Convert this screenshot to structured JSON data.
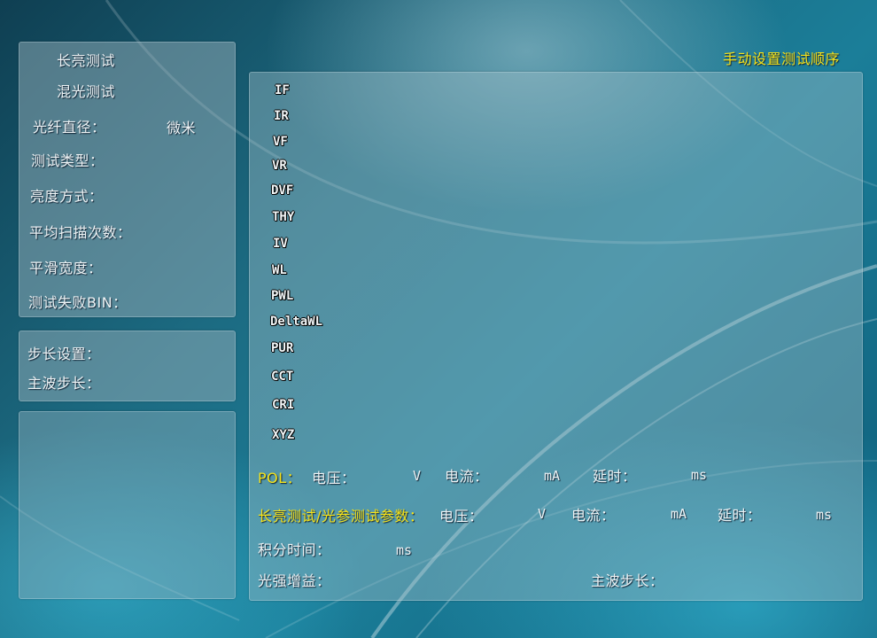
{
  "top_right_title": "手动设置测试顺序",
  "left_panel_1": {
    "long_bright_test": "长亮测试",
    "mixed_light_test": "混光测试",
    "fiber_diameter_label": "光纤直径：",
    "fiber_diameter_unit": "微米",
    "test_type_label": "测试类型：",
    "brightness_mode_label": "亮度方式：",
    "avg_scan_count_label": "平均扫描次数：",
    "smooth_width_label": "平滑宽度：",
    "fail_bin_label": "测试失败BIN："
  },
  "left_panel_2": {
    "step_setting_label": "步长设置：",
    "dominant_wave_step_label": "主波步长："
  },
  "test_items": [
    "IF",
    "IR",
    "VF",
    "VR",
    "DVF",
    "THY",
    "IV",
    "WL",
    "PWL",
    "DeltaWL",
    "PUR",
    "CCT",
    "CRI",
    "XYZ"
  ],
  "pol_row": {
    "title": "POL：",
    "voltage_label": "电压：",
    "voltage_unit": "V",
    "current_label": "电流：",
    "current_unit": "mA",
    "delay_label": "延时：",
    "delay_unit": "ms"
  },
  "long_bright_row": {
    "title": "长亮测试/光参测试参数：",
    "voltage_label": "电压：",
    "voltage_unit": "V",
    "current_label": "电流：",
    "current_unit": "mA",
    "delay_label": "延时：",
    "delay_unit": "ms"
  },
  "integration_row": {
    "label": "积分时间：",
    "unit": "ms"
  },
  "gain_row": {
    "gain_label": "光强增益：",
    "dominant_wave_step_label": "主波步长："
  }
}
